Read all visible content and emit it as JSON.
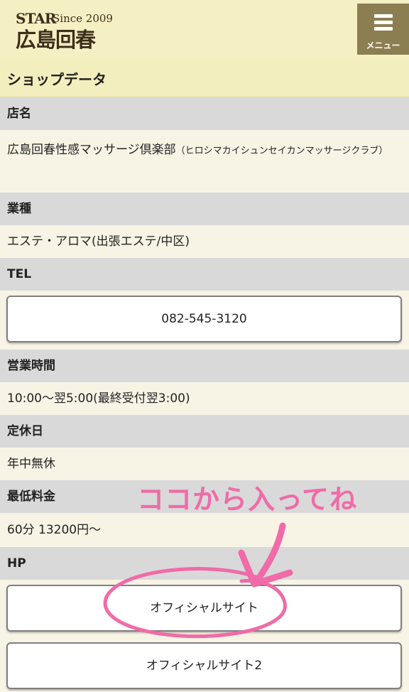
{
  "header": {
    "logo_star": "STAR",
    "logo_since": "Since 2009",
    "logo_name": "広島回春",
    "menu_label": "メニュー"
  },
  "section_title": "ショップデータ",
  "fields": {
    "shop_name_label": "店名",
    "shop_name_value": "広島回春性感マッサージ倶楽部",
    "shop_name_kana": "（ヒロシマカイシュンセイカンマッサージクラブ）",
    "industry_label": "業種",
    "industry_value": "エステ・アロマ(出張エステ/中区)",
    "tel_label": "TEL",
    "tel_button": "082-545-3120",
    "hours_label": "営業時間",
    "hours_value": "10:00〜翌5:00(最終受付翌3:00)",
    "holiday_label": "定休日",
    "holiday_value": "年中無休",
    "min_price_label": "最低料金",
    "min_price_value": "60分 13200円〜",
    "hp_label": "HP",
    "hp_button_1": "オフィシャルサイト",
    "hp_button_2": "オフィシャルサイト2"
  },
  "annotation": {
    "text": "ココから入ってね",
    "color": "#f06ba7"
  },
  "icons": [
    "hamburger-menu-icon"
  ]
}
